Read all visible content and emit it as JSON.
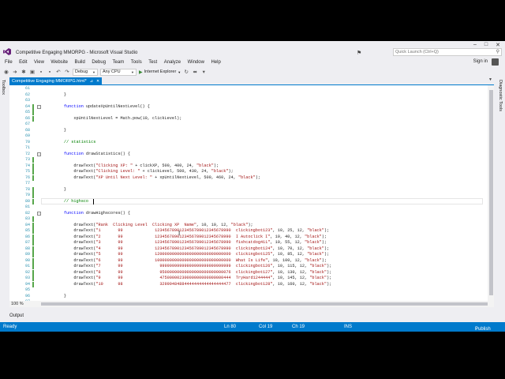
{
  "window": {
    "title": "Competitive Engaging MMORPG - Microsoft Visual Studio",
    "quick_launch_placeholder": "Quick Launch (Ctrl+Q)",
    "sign_in": "Sign in"
  },
  "menu": [
    "File",
    "Edit",
    "View",
    "Website",
    "Build",
    "Debug",
    "Team",
    "Tools",
    "Test",
    "Analyze",
    "Window",
    "Help"
  ],
  "toolbar": {
    "config": "Debug",
    "platform": "Any CPU",
    "run_target": "Internet Explorer"
  },
  "left_panel_label": "Toolbox",
  "right_panel_label": "Diagnostic Tools",
  "document_tab": {
    "name": "Competitive Engaging MMORPG.html*"
  },
  "editor": {
    "zoom": "100 %",
    "line_numbers": [
      "61",
      "62",
      "63",
      "64",
      "65",
      "66",
      "67",
      "68",
      "69",
      "70",
      "71",
      "72",
      "73",
      "74",
      "75",
      "76",
      "77",
      "78",
      "79",
      "80",
      "81",
      "82",
      "83",
      "84",
      "85",
      "86",
      "87",
      "88",
      "89",
      "90",
      "91",
      "92",
      "93",
      "94",
      "95",
      "96",
      "97"
    ],
    "lines": [
      "",
      "        }",
      "",
      "        function updateXpUntilNextLevel() {",
      "",
      "            xpUntilNextLevel = Math.pow(10, clickLevel);",
      "",
      "        }",
      "",
      "        // statistics",
      "",
      "        function drawStatistics() {",
      "",
      "            drawText(\"Clicking XP: \" + clickXP, 500, 400, 24, \"black\");",
      "            drawText(\"Clicking Level: \" + clickLevel, 500, 430, 24, \"black\");",
      "            drawText(\"XP Until Next Level: \" + xpUntilNextLevel, 500, 460, 24, \"black\");",
      "",
      "        }",
      "",
      "        // highsco",
      "",
      "        function drawHighscores() {",
      "",
      "            drawText(\"Rank  Clicking Level  Clicking XP  Name\", 10, 10, 12, \"black\");",
      "            drawText(\"1       99             1234567890123456789012345678990  clickingbot123\", 10, 25, 12, \"black\");",
      "            drawText(\"2       99             1234567890123456789012345678990  I Autoclick I\", 10, 40, 12, \"black\");",
      "            drawText(\"3       99             1234567890123456789012345678990  fishcatdog411\", 10, 55, 12, \"black\");",
      "            drawText(\"4       99             1234567890123456789012345678990  clickingbot124\", 10, 70, 12, \"black\");",
      "            drawText(\"5       99             1200000000000000000000000000000  clickingbot125\", 10, 85, 12, \"black\");",
      "            drawText(\"6       99             1000000000000000000000000000000  What Is Life\", 10, 100, 12, \"black\");",
      "            drawText(\"7       99               99999999999999999999999999999  clickingbot126\", 10, 115, 12, \"black\");",
      "            drawText(\"8       99               95000000000000000000000000076  clickingbot127\", 10, 130, 12, \"black\");",
      "            drawText(\"9       99               47500000230000000000000000444  TryHard1244444\", 10, 145, 12, \"black\");",
      "            drawText(\"10      98               32999484884444444444444444477  clickingbot128\", 10, 160, 12, \"black\");",
      "",
      "        }",
      ""
    ]
  },
  "output_tab": "Output",
  "status": {
    "left": "Ready",
    "ln": "Ln 80",
    "col": "Col 19",
    "ch": "Ch 19",
    "ins": "INS",
    "publish": "Publish"
  },
  "colors": {
    "accent": "#007acc",
    "chrome": "#eeeef2",
    "keyword": "#0000ff",
    "string": "#a31515",
    "comment": "#008000",
    "line_number": "#2b91af",
    "change_marker": "#57a64a"
  }
}
